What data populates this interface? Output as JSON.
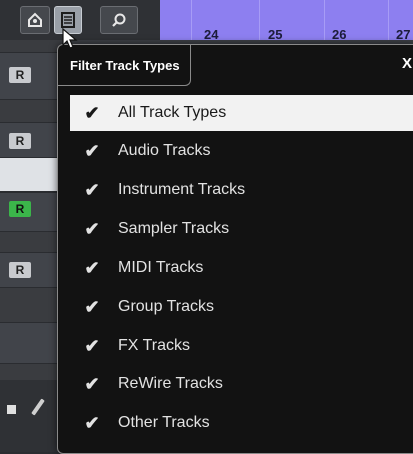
{
  "ruler": {
    "numbers": [
      "24",
      "25",
      "26",
      "27"
    ]
  },
  "tracks": {
    "record_label": "R"
  },
  "popup": {
    "title": "Filter Track Types",
    "close_label": "X",
    "check_glyph": "✔",
    "items": [
      {
        "label": "All Track Types",
        "checked": true,
        "selected": true
      },
      {
        "label": "Audio Tracks",
        "checked": true
      },
      {
        "label": "Instrument Tracks",
        "checked": true
      },
      {
        "label": "Sampler Tracks",
        "checked": true
      },
      {
        "label": "MIDI Tracks",
        "checked": true
      },
      {
        "label": "Group Tracks",
        "checked": true
      },
      {
        "label": "FX Tracks",
        "checked": true
      },
      {
        "label": "ReWire Tracks",
        "checked": true
      },
      {
        "label": "Other Tracks",
        "checked": true
      }
    ]
  },
  "icons": {
    "toolbar": [
      "workspace-icon",
      "filter-track-types-icon",
      "search-icon"
    ]
  },
  "colors": {
    "ruler": "#8d7ff0",
    "record_active": "#3bb54a",
    "popup_background": "#121212",
    "selected_item": "#f2f2f2"
  }
}
